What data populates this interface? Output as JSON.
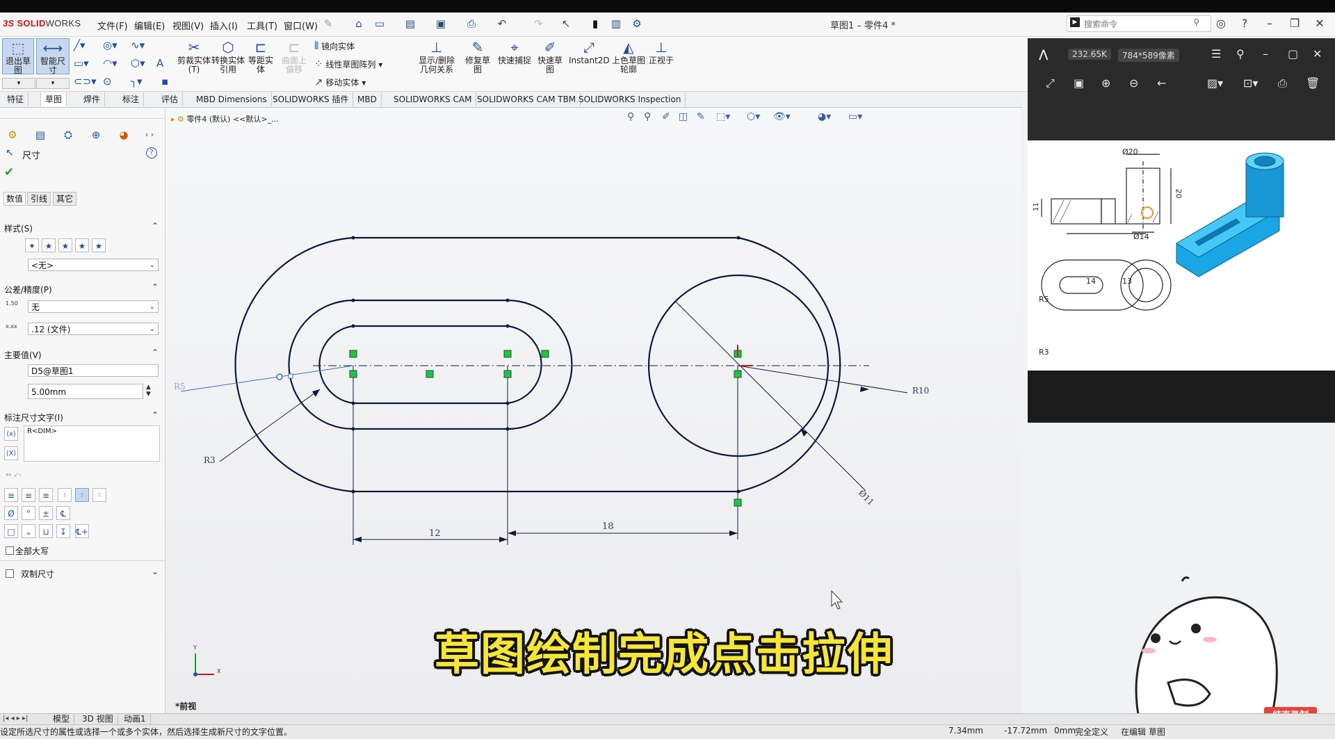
{
  "app": {
    "logo_prefix": "3S",
    "logo_name": "SOLID",
    "logo_name2": "WORKS",
    "doc_title": "草图1 – 零件4 *"
  },
  "menu": [
    "文件(F)",
    "编辑(E)",
    "视图(V)",
    "插入(I)",
    "工具(T)",
    "窗口(W)"
  ],
  "search": {
    "placeholder": "搜索命令"
  },
  "ribbon": {
    "exit_sketch": "退出草图",
    "smart_dim": "智能尺寸",
    "trim": "剪裁实体(T)",
    "convert": "转换实体引用",
    "offset": "等距实体",
    "surface_offset": "曲面上偏移",
    "mirror": "镜向实体",
    "linear_pattern": "线性草图阵列",
    "move": "移动实体",
    "display_delete": "显示/删除几何关系",
    "repair": "修复草图",
    "quick_snap": "快速捕捉",
    "rapid_sketch": "快速草图",
    "instant2d": "Instant2D",
    "shaded": "上色草图轮廓",
    "normal_to": "正视于"
  },
  "cmd_tabs": [
    "特征",
    "草图",
    "焊件",
    "标注",
    "评估",
    "MBD Dimensions",
    "SOLIDWORKS 插件",
    "MBD",
    "SOLIDWORKS CAM",
    "SOLIDWORKS CAM TBM",
    "SOLIDWORKS Inspection"
  ],
  "pm": {
    "title": "尺寸",
    "subtabs": [
      "数值",
      "引线",
      "其它"
    ],
    "style_header": "样式(S)",
    "style_value": "<无>",
    "tol_header": "公差/精度(P)",
    "tol_value": "无",
    "prec_value": ".12 (文件)",
    "primary_header": "主要值(V)",
    "primary_name": "D5@草图1",
    "primary_value": "5.00mm",
    "dimtext_header": "标注尺寸文字(I)",
    "dimtext_value": "R<DIM>",
    "all_caps": "全部大写",
    "dual_dim": "双制尺寸"
  },
  "breadcrumb": "零件4 (默认) <<默认>_...",
  "drawing": {
    "dim_12": "12",
    "dim_18": "18",
    "label_r5": "R5",
    "label_r3": "R3",
    "label_r10": "R10",
    "label_d11": "Ø11"
  },
  "viewer": {
    "size": "232.65K",
    "dims": "784*589像素"
  },
  "ref_image": {
    "d20": "Ø20",
    "d14": "Ø14",
    "h20": "20",
    "h11": "11",
    "w14": "14",
    "w13": "13",
    "r5": "R5",
    "r3": "R3"
  },
  "front_view": "*前视",
  "bottom_tabs": [
    "模型",
    "3D 视图",
    "动画1"
  ],
  "status": {
    "hint": "设定所选尺寸的属性或选择一个或多个实体，然后选择生成新尺寸的文字位置。",
    "x": "7.34mm",
    "y": "-17.72mm",
    "z": "0mm",
    "defined": "完全定义",
    "editing": "在编辑 草图"
  },
  "subtitle": "草图绘制完成点击拉伸",
  "stop_record": "结束录制",
  "colors": {
    "sketch_line": "#0b1a3a",
    "accent": "#1f4f9c",
    "relation": "#22c247",
    "subtitle": "#f7e636"
  }
}
